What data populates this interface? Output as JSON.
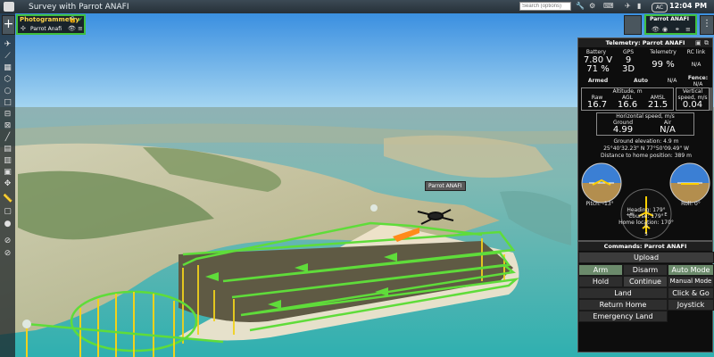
{
  "window": {
    "title": "Survey with Parrot ANAFI",
    "search_placeholder": "Search (options)",
    "ac_badge": "AC",
    "clock": "12:04 PM"
  },
  "mission_panel": {
    "title": "Photogrammetry",
    "vehicle": "Parrot Anafi"
  },
  "vehicle_panel": {
    "title": "Parrot ANAFI"
  },
  "telemetry": {
    "title": "Telemetry: Parrot ANAFI",
    "headers": [
      "Battery",
      "GPS",
      "Telemetry",
      "RC link"
    ],
    "battery_voltage": "7.80 V",
    "battery_percent": "71 %",
    "gps_sats": "9",
    "gps_fix": "3D",
    "telemetry_pct": "99 %",
    "rc_link": "N/A",
    "armed": "Armed",
    "mode": "Auto",
    "mode_val": "N/A",
    "fence_label": "Fence:",
    "fence_val": "N/A",
    "altitude_title": "Altitude, m",
    "alt_headers": [
      "Raw",
      "AGL",
      "AMSL"
    ],
    "alt_values": [
      "16.7",
      "16.6",
      "21.5"
    ],
    "vspeed_title": "Vertical speed, m/s",
    "vspeed": "0.04",
    "hspeed_title": "Horizontal speed, m/s",
    "hs_headers": [
      "Ground",
      "Air"
    ],
    "hs_values": [
      "4.99",
      "N/A"
    ],
    "ground_elev": "Ground elevation: 4.9 m",
    "coords": "25°40'32.23\" N  77°50'09.49\" W",
    "home_dist": "Distance to home position: 389 m",
    "heading": "Heading: 179°",
    "course": "Course: 179°",
    "home_loc": "Home location: 170°",
    "pitch": "Pitch: -13°",
    "roll": "Roll: 0°",
    "compass_n": "N",
    "compass_s": "S",
    "compass_e": "E",
    "compass_w": "+W"
  },
  "commands": {
    "title": "Commands: Parrot ANAFI",
    "upload": "Upload",
    "arm": "Arm",
    "disarm": "Disarm",
    "auto_mode": "Auto Mode",
    "hold": "Hold",
    "continue": "Continue",
    "manual_mode": "Manual Mode",
    "land": "Land",
    "click_go": "Click & Go",
    "return_home": "Return Home",
    "joystick": "Joystick",
    "emergency_land": "Emergency Land"
  },
  "map": {
    "drone_label": "Parrot ANAFI"
  },
  "colors": {
    "accent_green": "#3fbf3f",
    "panel_bg": "#0d0d0d",
    "route_green": "#5fdc3a",
    "route_yellow": "#f2d21b"
  }
}
